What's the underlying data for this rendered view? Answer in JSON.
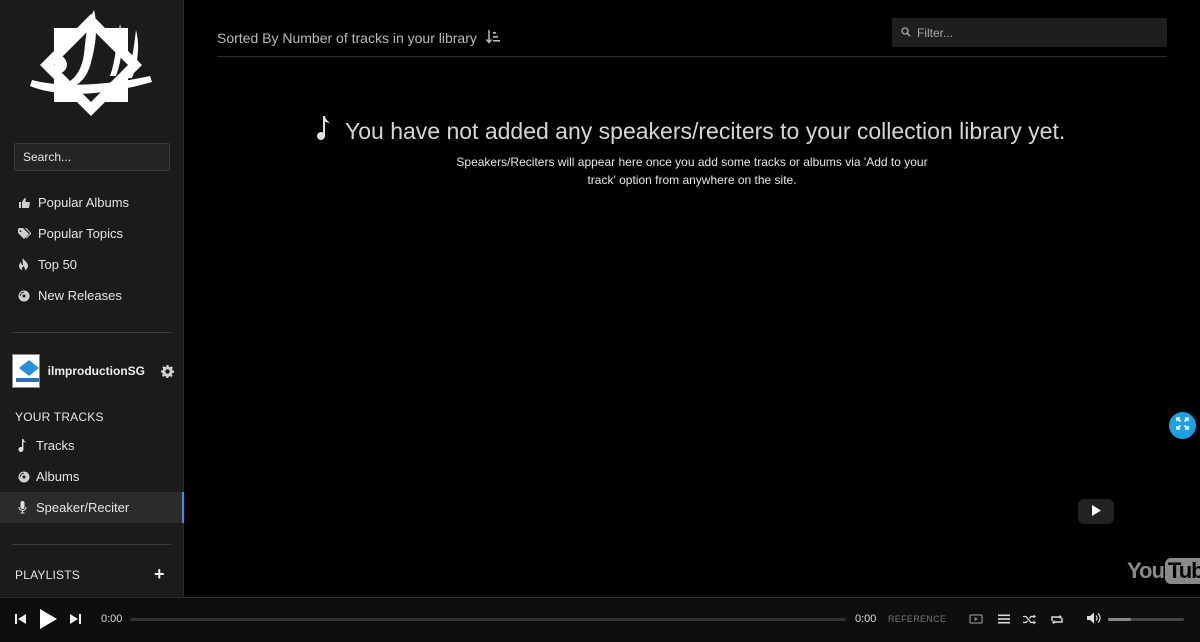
{
  "sidebar": {
    "search_placeholder": "Search...",
    "nav": [
      {
        "label": "Popular Albums",
        "icon": "thumbs-up-icon"
      },
      {
        "label": "Popular Topics",
        "icon": "tags-icon"
      },
      {
        "label": "Top 50",
        "icon": "fire-icon"
      },
      {
        "label": "New Releases",
        "icon": "disc-icon"
      }
    ],
    "profile": {
      "name": "ilmproductionSG"
    },
    "your_tracks_label": "YOUR TRACKS",
    "your_tracks": [
      {
        "label": "Tracks",
        "icon": "music-note-icon"
      },
      {
        "label": "Albums",
        "icon": "disc-icon"
      },
      {
        "label": "Speaker/Reciter",
        "icon": "microphone-icon",
        "active": true
      }
    ],
    "playlists_label": "PLAYLISTS",
    "add_playlist": "+"
  },
  "main": {
    "sort_label": "Sorted By Number of tracks in your library",
    "filter_placeholder": "Filter...",
    "empty_title": "You have not added any speakers/reciters to your collection library yet.",
    "empty_subtitle": "Speakers/Reciters will appear here once you add some tracks or albums via 'Add to your track' option from anywhere on the site.",
    "youtube_logo": {
      "you": "You",
      "tube": "Tube"
    }
  },
  "player": {
    "current_time": "0:00",
    "total_time": "0:00",
    "reference_label": "REFERENCE",
    "volume_level": 0.3
  },
  "colors": {
    "accent": "#1ea0e6",
    "sidebar_bg": "#1b1b1b",
    "main_bg": "#000000"
  }
}
